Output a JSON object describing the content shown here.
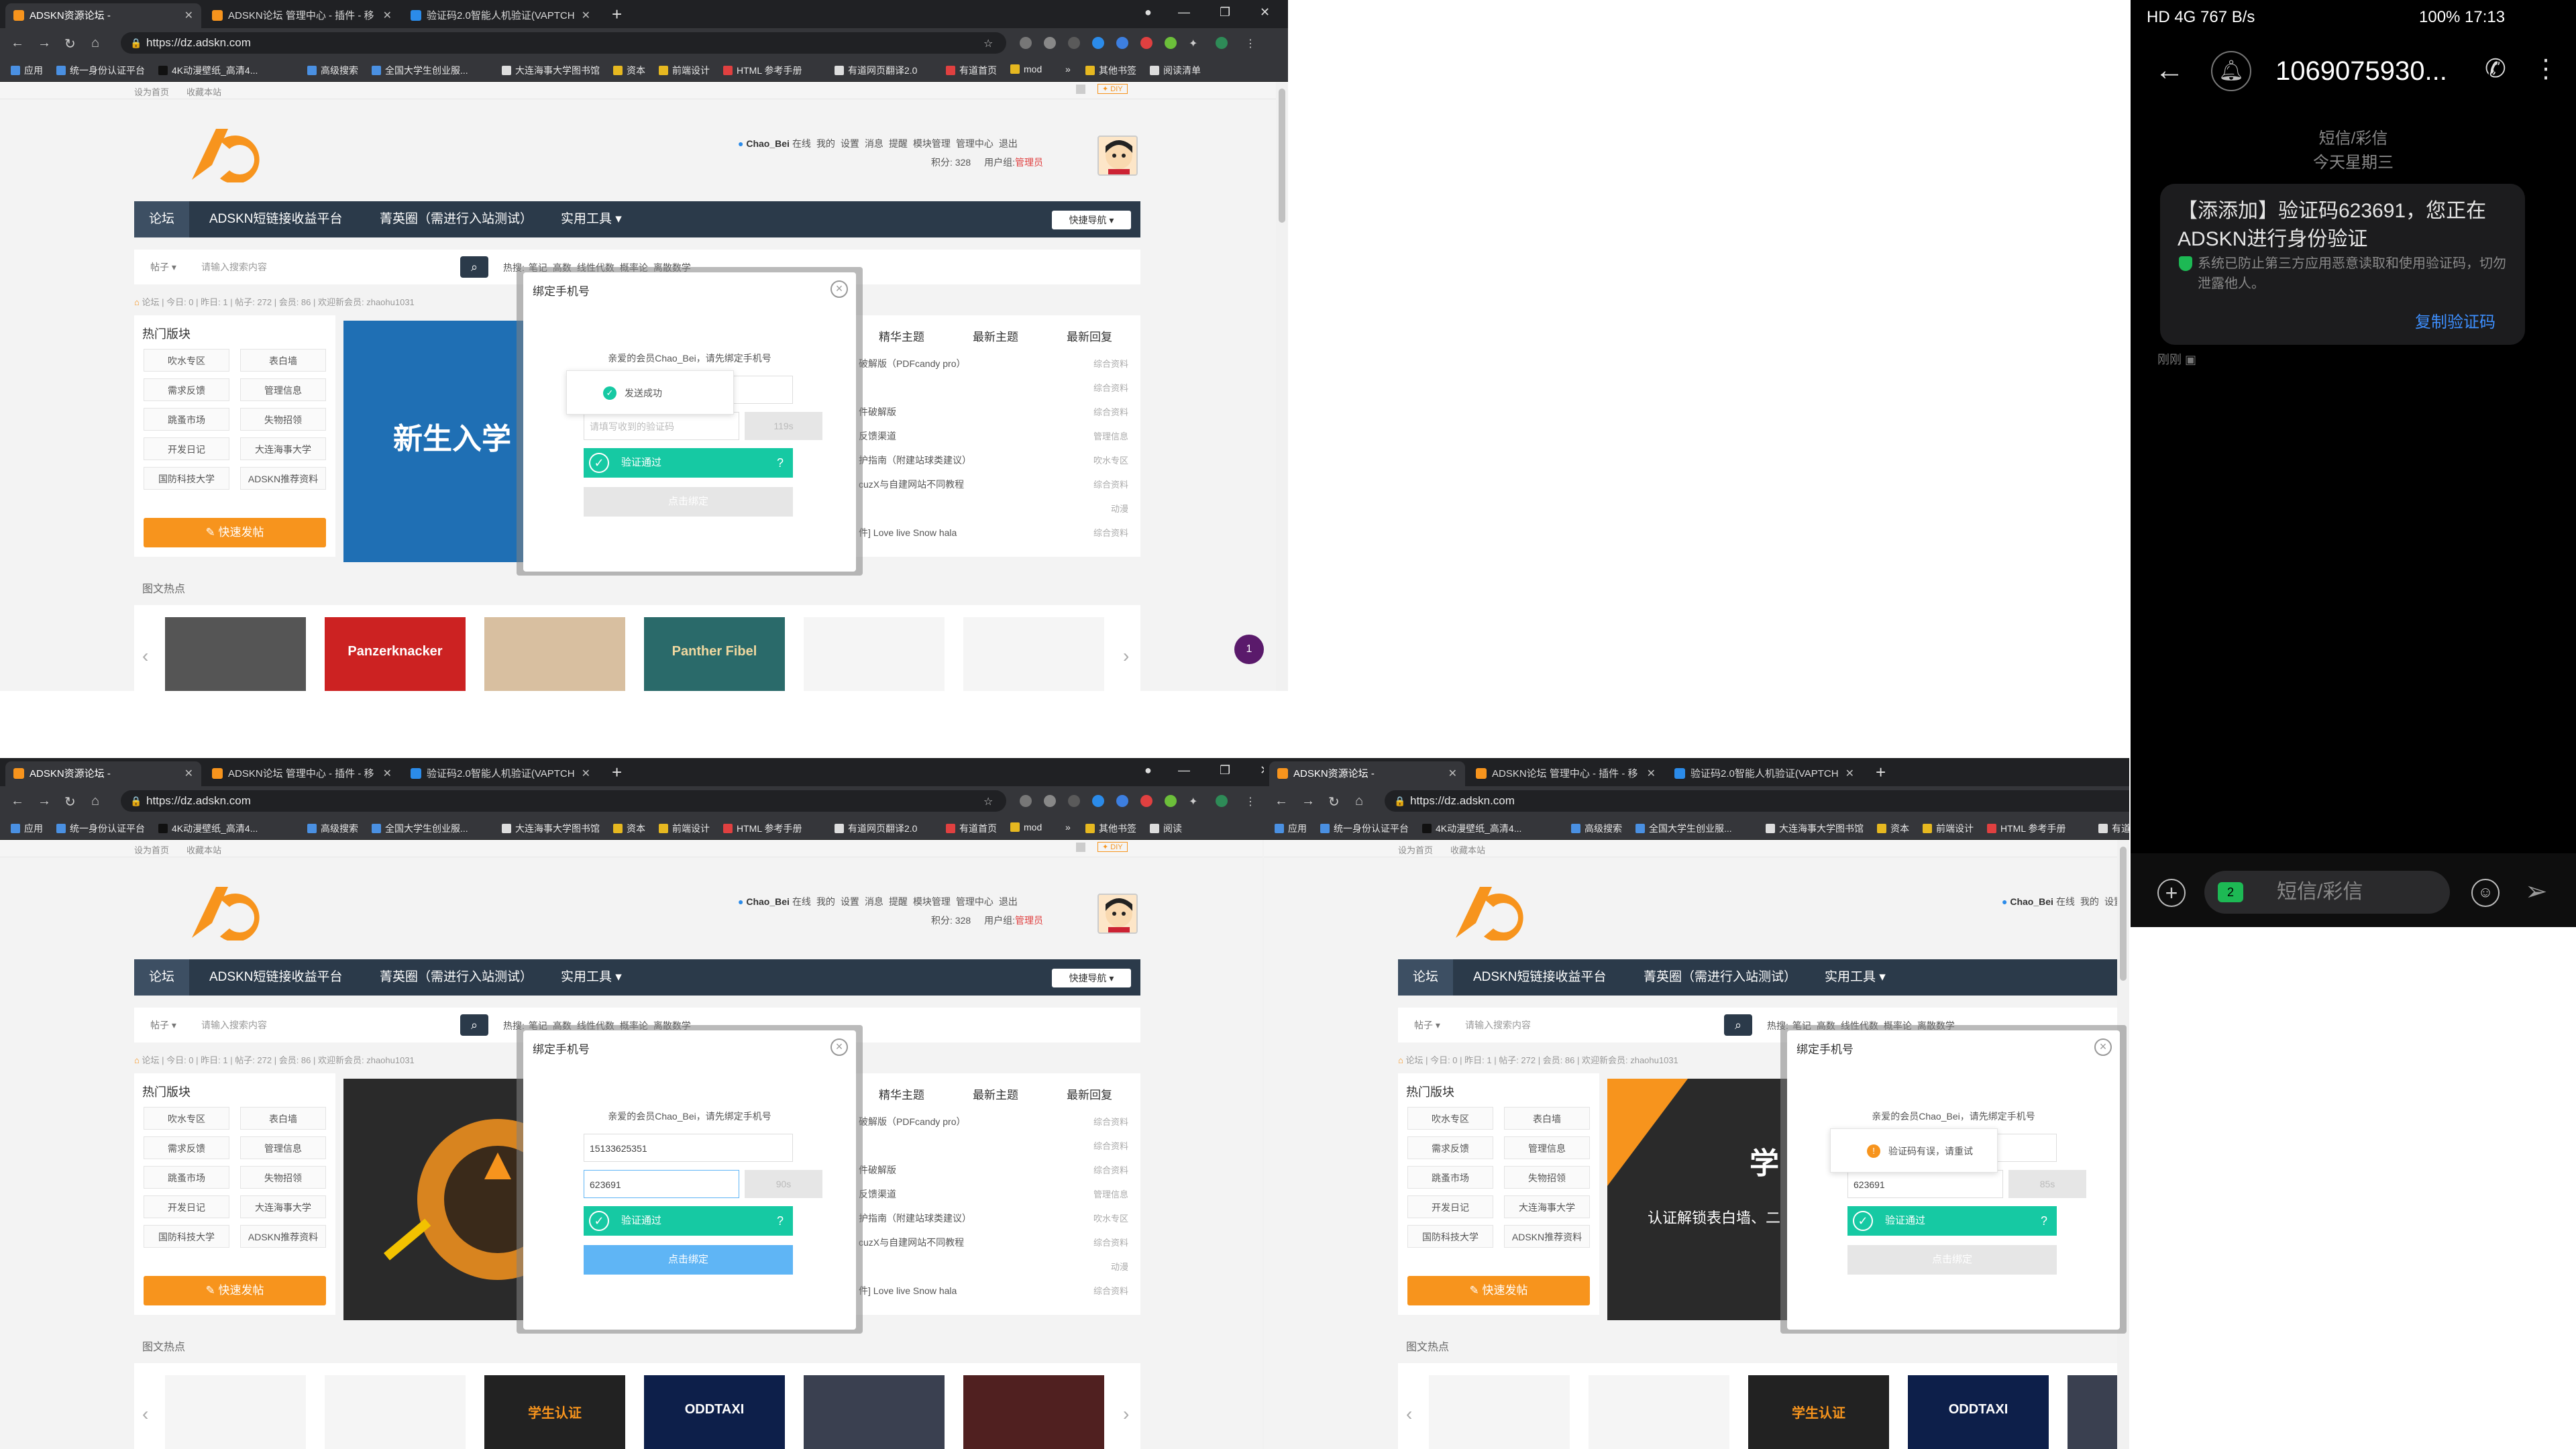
{
  "browser": {
    "tabs": [
      {
        "title": "ADSKN资源论坛 -",
        "color": "#f7941d"
      },
      {
        "title": "ADSKN论坛 管理中心 - 插件 - 移",
        "color": "#f7941d"
      },
      {
        "title": "验证码2.0智能人机验证(VAPTCH",
        "color": "#2b8be9"
      }
    ],
    "new_tab": "+",
    "url": "https://dz.adskn.com",
    "bookmarks": [
      "应用",
      "统一身份认证平台",
      "4K动漫壁纸_高清4...",
      "高级搜索",
      "全国大学生创业服...",
      "大连海事大学图书馆",
      "资本",
      "前端设计",
      "HTML 参考手册",
      "有道网页翻译2.0",
      "有道首页",
      "mod",
      "»",
      "其他书签",
      "阅读清单"
    ],
    "bookmarks_short": [
      "应用",
      "统一身份认证平台",
      "4K动漫壁纸_高清4...",
      "高级搜索",
      "全国大学生创业服...",
      "大连海事大学图书馆",
      "资本",
      "前端设计",
      "HTML 参考手册",
      "有道网页翻译2.0",
      "有道首页",
      "mod",
      "»",
      "其他书签",
      "阅读"
    ]
  },
  "site": {
    "top_links": [
      "设为首页",
      "收藏本站"
    ],
    "diy": "✦ DIY",
    "user": {
      "name": "Chao_Bei",
      "online": "在线",
      "links": [
        "我的",
        "设置",
        "消息",
        "提醒",
        "模块管理",
        "管理中心",
        "退出"
      ],
      "points": "积分: 328",
      "group_label": "用户组:",
      "group": "管理员"
    },
    "nav": [
      "论坛",
      "ADSKN短链接收益平台",
      "菁英圈（需进行入站测试）",
      "实用工具"
    ],
    "quick_nav": "快捷导航",
    "search": {
      "type": "帖子",
      "placeholder": "请输入搜索内容",
      "hot_label": "热搜:",
      "hot": [
        "笔记",
        "高数",
        "线性代数",
        "概率论",
        "离散数学"
      ]
    },
    "breadcrumb": "论坛 | 今日: 0 | 昨日: 1 | 帖子: 272 | 会员: 86 | 欢迎新会员: zhaohu1031",
    "hot_title": "热门版块",
    "hot_items": [
      "吹水专区",
      "表白墙",
      "需求反馈",
      "管理信息",
      "跳蚤市场",
      "失物招领",
      "开发日记",
      "大连海事大学",
      "国防科技大学",
      "ADSKN推荐资料"
    ],
    "post_button": "快速发帖",
    "list_tabs": [
      "精华主题",
      "最新主题",
      "最新回复"
    ],
    "list_items": [
      {
        "t": "破解版（PDFcandy pro）",
        "c": "综合资料"
      },
      {
        "t": "",
        "c": "综合资料"
      },
      {
        "t": "件破解版",
        "c": "综合资料"
      },
      {
        "t": "反馈渠道",
        "c": "管理信息"
      },
      {
        "t": "护指南（附建站球类建议）",
        "c": "吹水专区"
      },
      {
        "t": "cuzX与自建网站不同教程",
        "c": "综合资料"
      },
      {
        "t": "",
        "c": "动漫"
      },
      {
        "t": "件] Love live Snow hala",
        "c": "综合资料"
      }
    ],
    "image_hot_title": "图文热点",
    "banner_text_1": "新生入学",
    "banner_text_3a": "学",
    "banner_text_3b": "认证解锁表白墙、二",
    "thumb_labels": [
      "Panzerknacker",
      "Panther Fibel",
      "学生认证",
      "ODDTAXI"
    ]
  },
  "modal": {
    "title": "绑定手机号",
    "greeting": "亲爱的会员Chao_Bei，请先绑定手机号",
    "phone_value": "15133625351",
    "code_value": "623691",
    "code_placeholder": "请填写收到的验证码",
    "sms_countdown_a": "119s",
    "sms_countdown_b": "90s",
    "sms_countdown_c": "85s",
    "verify_label": "验证通过",
    "help": "?",
    "bind_label": "点击绑定",
    "toast_success": "发送成功",
    "toast_error": "验证码有误，请重试"
  },
  "phone": {
    "status_left": "HD 4G 767 B/s",
    "status_right": "100% 17:13",
    "number": "1069075930...",
    "subtitle": "短信/彩信",
    "date": "今天星期三",
    "message": "【添添加】验证码623691，您正在ADSKN进行身份验证",
    "note": "系统已防止第三方应用恶意读取和使用验证码，切勿泄露他人。",
    "copy": "复制验证码",
    "time": "刚刚",
    "input_placeholder": "短信/彩信",
    "sim": "2"
  },
  "notification_badge": "1",
  "colors": {
    "accent": "#f7941d",
    "nav": "#2b3a4a",
    "verify": "#16c9a3",
    "bind_active": "#5fb5f5",
    "link": "#3d8fff"
  }
}
